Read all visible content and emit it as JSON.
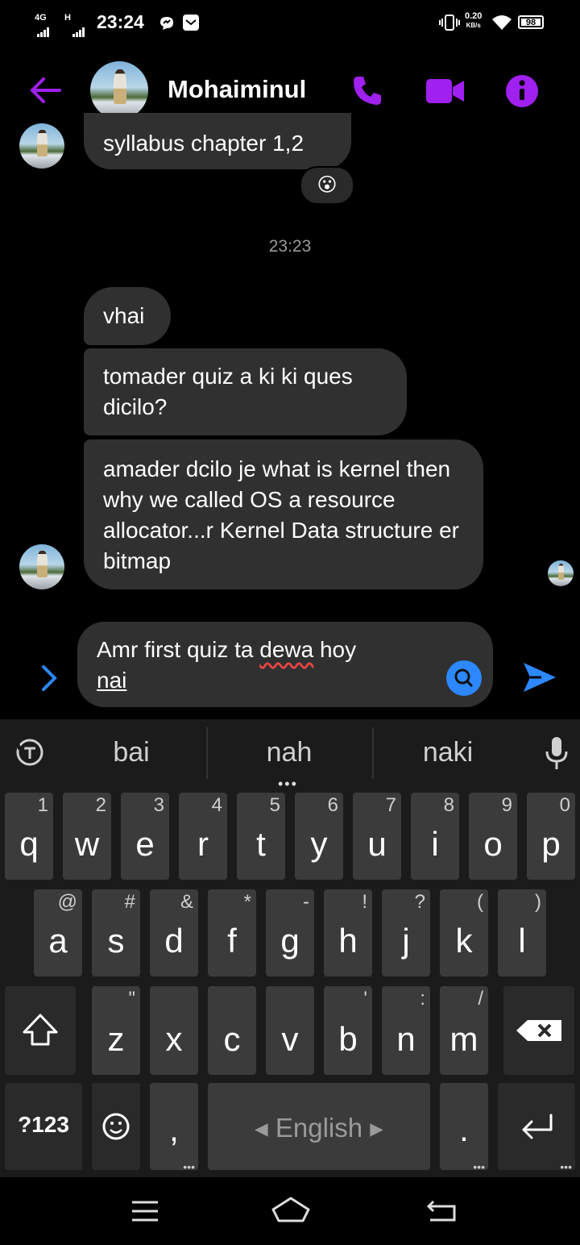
{
  "status_bar": {
    "network_label": "4G",
    "network2_label": "H",
    "time": "23:24",
    "speed_value": "0.20",
    "speed_unit": "KB/s",
    "battery": "98"
  },
  "header": {
    "contact_name": "Mohaiminul",
    "accent_color": "#a020f0"
  },
  "messages": [
    {
      "text": "syllabus chapter 1,2"
    },
    {
      "text": "vhai"
    },
    {
      "text": "tomader quiz a ki ki ques dicilo?"
    },
    {
      "text": "amader dcilo je what is kernel then why we called OS a resource allocator...r Kernel Data structure er bitmap"
    }
  ],
  "reaction": "😮",
  "timestamp": "23:23",
  "composer": {
    "draft_line1": "Amr first quiz ta ",
    "draft_misspelled": "dewa",
    "draft_line1_end": " hoy",
    "draft_line2": "nai"
  },
  "keyboard": {
    "suggestions": [
      "bai",
      "nah",
      "naki"
    ],
    "row1": [
      [
        "q",
        "1"
      ],
      [
        "w",
        "2"
      ],
      [
        "e",
        "3"
      ],
      [
        "r",
        "4"
      ],
      [
        "t",
        "5"
      ],
      [
        "y",
        "6"
      ],
      [
        "u",
        "7"
      ],
      [
        "i",
        "8"
      ],
      [
        "o",
        "9"
      ],
      [
        "p",
        "0"
      ]
    ],
    "row2": [
      [
        "a",
        "@"
      ],
      [
        "s",
        "#"
      ],
      [
        "d",
        "&"
      ],
      [
        "f",
        "*"
      ],
      [
        "g",
        "-"
      ],
      [
        "h",
        "!"
      ],
      [
        "j",
        "?"
      ],
      [
        "k",
        "("
      ],
      [
        "l",
        ")"
      ]
    ],
    "row3": [
      [
        "z",
        "\""
      ],
      [
        "x",
        ""
      ],
      [
        "c",
        ""
      ],
      [
        "v",
        ""
      ],
      [
        "b",
        "'"
      ],
      [
        "n",
        ":"
      ],
      [
        "m",
        "/"
      ]
    ],
    "symbols_label": "?123",
    "comma_label": ",",
    "space_label": "English",
    "period_label": "."
  }
}
